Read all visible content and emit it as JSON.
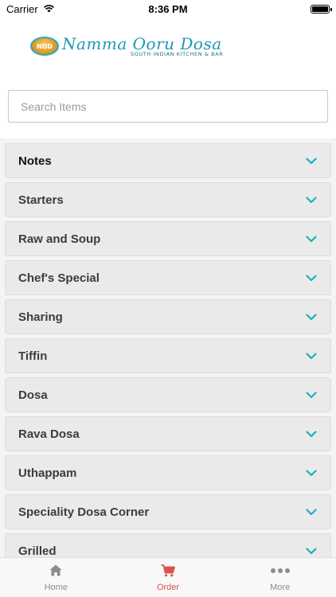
{
  "status_bar": {
    "carrier": "Carrier",
    "time": "8:36 PM"
  },
  "header": {
    "logo_badge": "NOD",
    "logo_title": "Namma Ooru Dosa",
    "logo_subtitle": "South Indian Kitchen & Bar"
  },
  "search": {
    "placeholder": "Search Items",
    "value": ""
  },
  "menu": {
    "items": [
      {
        "label": "Notes"
      },
      {
        "label": "Starters"
      },
      {
        "label": "Raw and Soup"
      },
      {
        "label": "Chef's Special"
      },
      {
        "label": "Sharing"
      },
      {
        "label": "Tiffin"
      },
      {
        "label": "Dosa"
      },
      {
        "label": "Rava Dosa"
      },
      {
        "label": "Uthappam"
      },
      {
        "label": "Speciality Dosa Corner"
      },
      {
        "label": "Grilled"
      }
    ]
  },
  "tab_bar": {
    "tabs": [
      {
        "label": "Home",
        "icon": "home-icon",
        "active": false
      },
      {
        "label": "Order",
        "icon": "cart-icon",
        "active": true
      },
      {
        "label": "More",
        "icon": "more-icon",
        "active": false
      }
    ]
  },
  "colors": {
    "accent": "#1ab0c0",
    "active_tab": "#d9534f",
    "inactive_tab": "#8c8c8c"
  }
}
